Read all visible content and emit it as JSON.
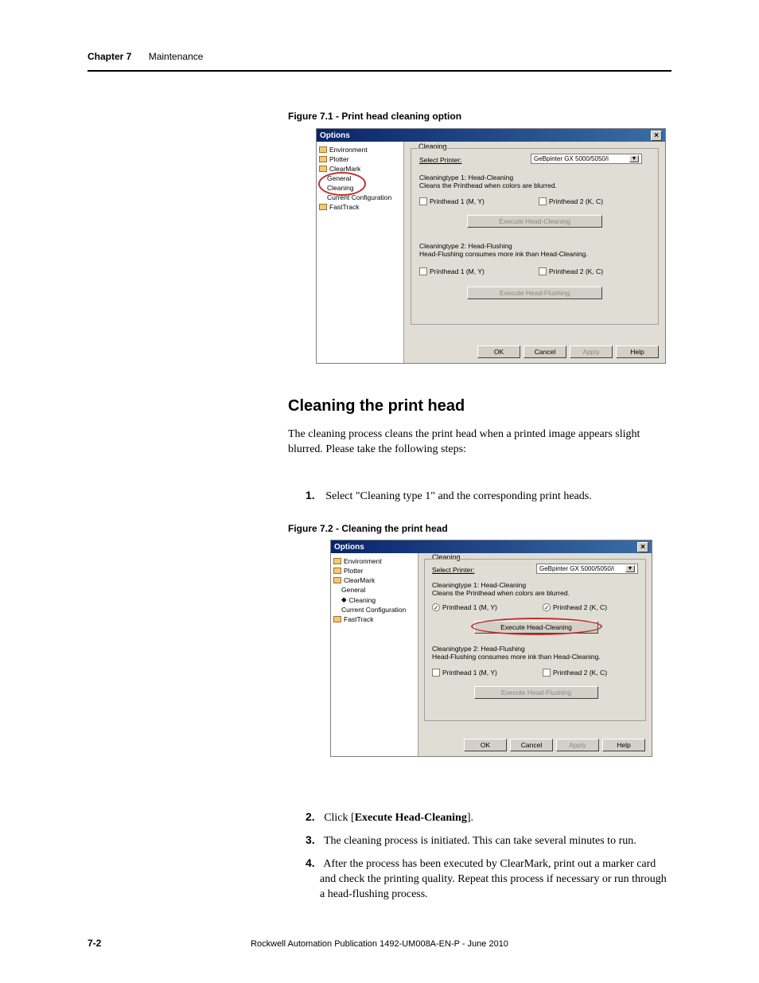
{
  "header": {
    "chapter": "Chapter 7",
    "section": "Maintenance"
  },
  "fig1_caption": "Figure 7.1 - Print head cleaning option",
  "fig2_caption": "Figure 7.2 - Cleaning the print head",
  "heading": "Cleaning the print head",
  "para1": "The cleaning process cleans the print head when a printed image appears slight blurred. Please take the following steps:",
  "steps": {
    "s1_num": "1.",
    "s1_text": "Select \"Cleaning type 1\" and the corresponding print heads.",
    "s2_num": "2.",
    "s2_a": "Click [",
    "s2_b": "Execute Head-Cleaning",
    "s2_c": "].",
    "s3_num": "3.",
    "s3_text": "The cleaning process is initiated. This can take several minutes to run.",
    "s4_num": "4.",
    "s4_text": "After the process has been executed by ClearMark, print out a marker card and check the printing quality. Repeat this process if necessary or run through a head-flushing process."
  },
  "page_num": "7-2",
  "pub_id": "Rockwell Automation Publication 1492-UM008A-EN-P - June 2010",
  "dialog": {
    "title": "Options",
    "close_x": "×",
    "tree": {
      "env": "Environment",
      "plotter": "Plotter",
      "clearmark": "ClearMark",
      "general": "General",
      "cleaning": "Cleaning",
      "current_config": "Current Configuration",
      "fasttrack": "FastTrack"
    },
    "gb_main": "Cleaning",
    "select_printer_lbl": "Select Printer:",
    "printer_value": "GeBpinter GX 5000/5050/i",
    "ct1_title": "Cleaningtype 1: Head-Cleaning",
    "ct1_desc": "Cleans the Printhead when colors are blurred.",
    "ph1_my": "Printhead 1 (M, Y)",
    "ph2_kc": "Printhead 2 (K, C)",
    "ph1_my_u": "Printhead 1 (M, Y)",
    "exec_clean": "Execute Head-Cleaning",
    "ct2_title": "Cleaningtype 2: Head-Flushing",
    "ct2_desc": "Head-Flushing consumes more ink than Head-Cleaning.",
    "exec_flush": "Execute Head-Flushing",
    "ok": "OK",
    "cancel": "Cancel",
    "apply": "Apply",
    "help": "Help"
  }
}
